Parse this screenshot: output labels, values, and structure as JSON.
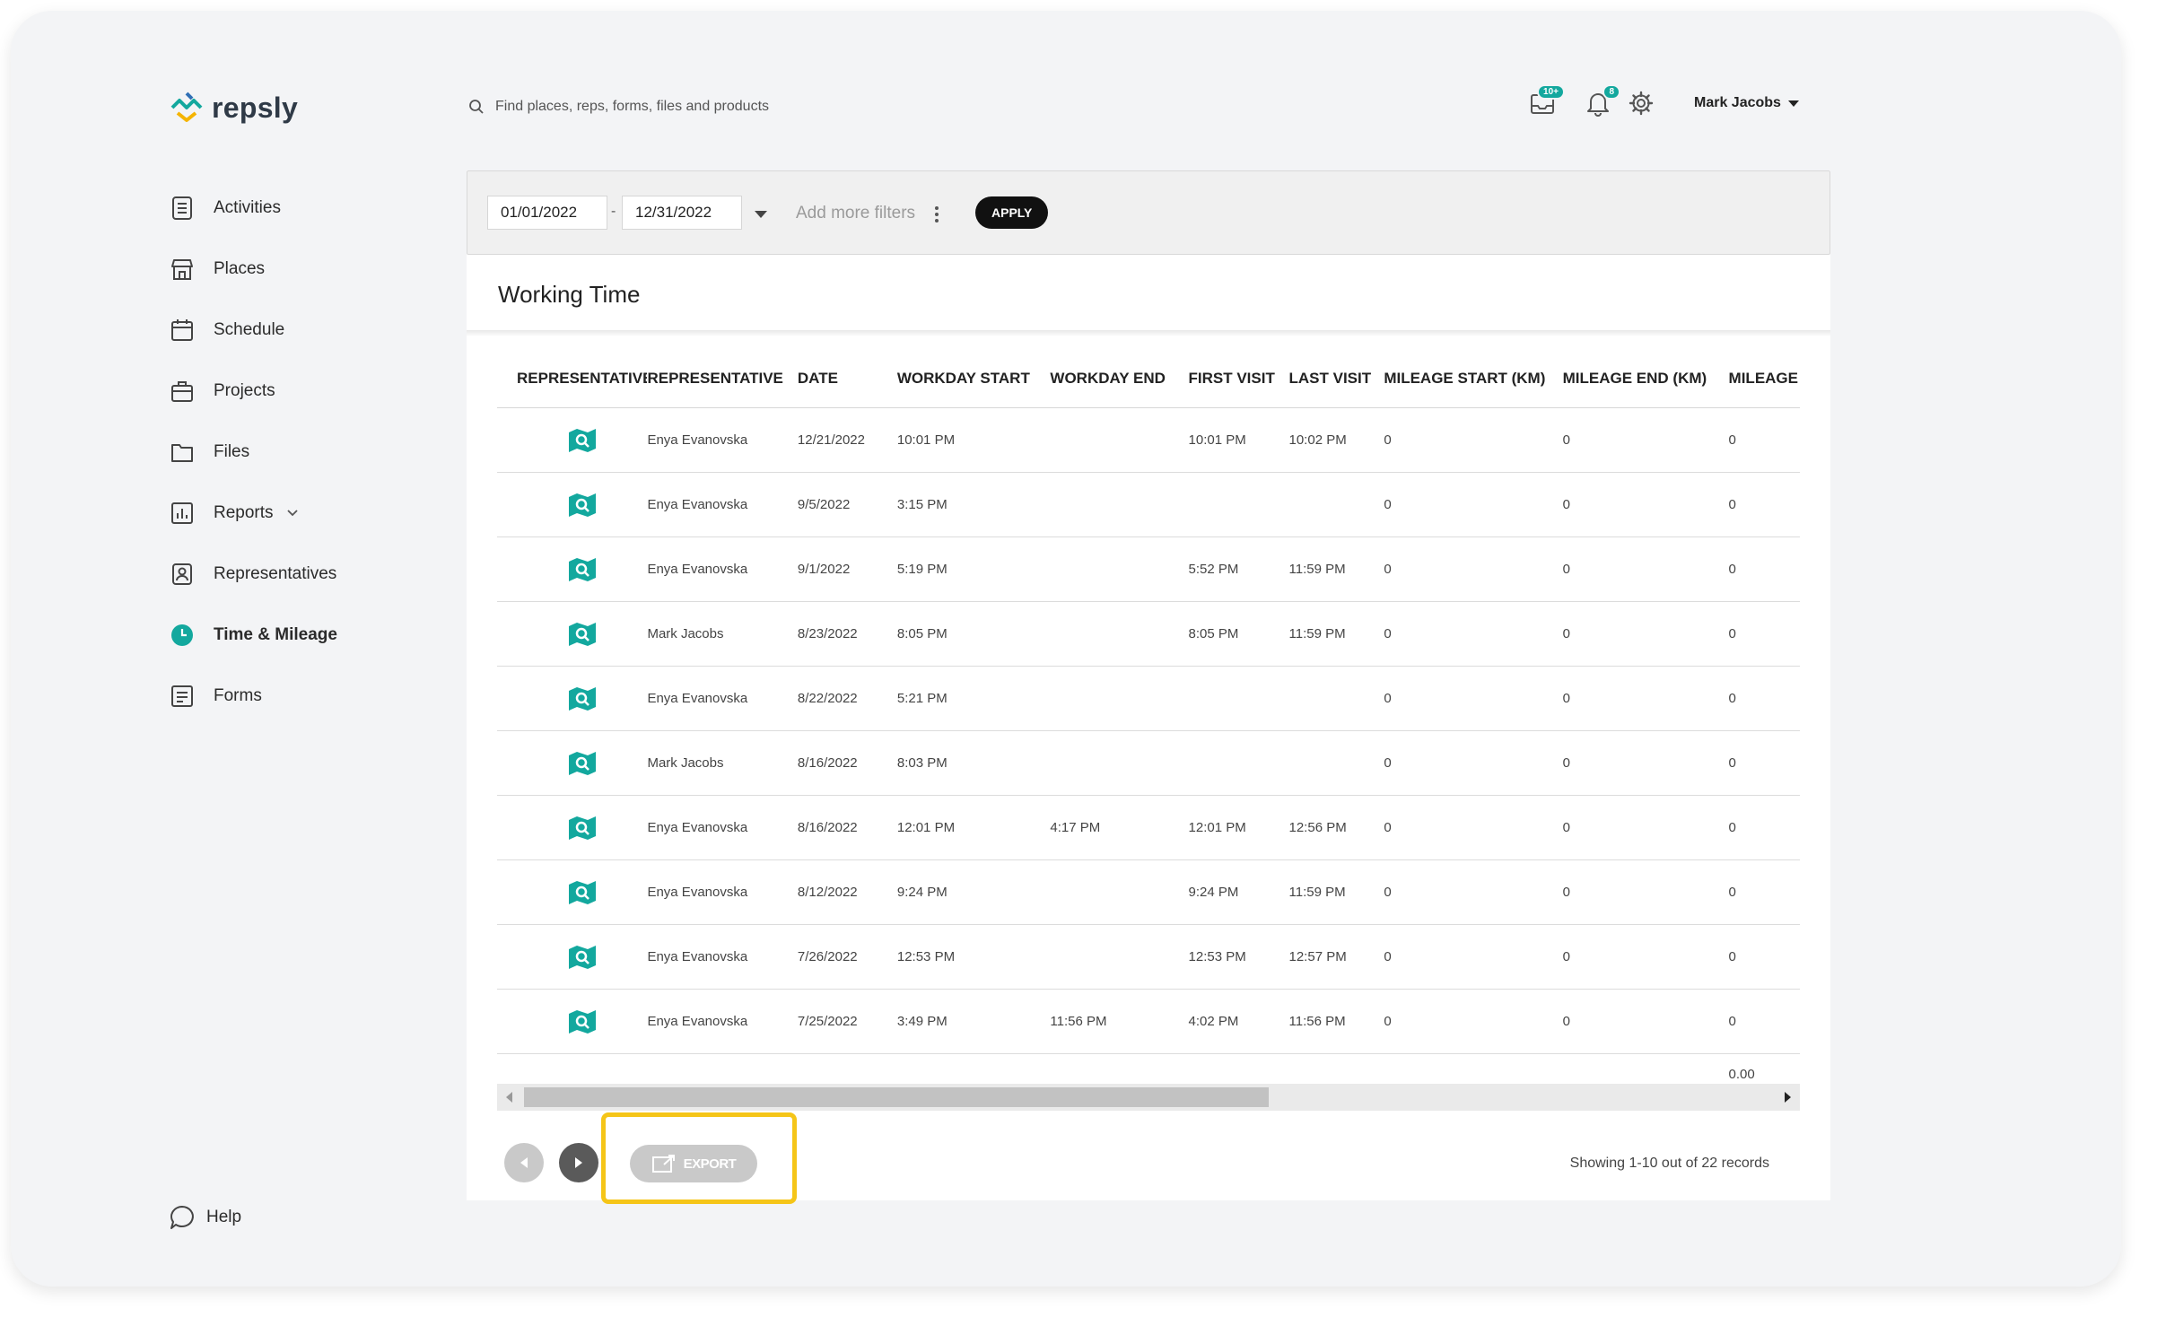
{
  "app": {
    "logo_text": "repsly",
    "brand_color": "#13a89e",
    "highlight_color": "#f5c518"
  },
  "search": {
    "placeholder": "Find places, reps, forms, files and products",
    "icon": "search-icon"
  },
  "header": {
    "inbox_badge": "10+",
    "notification_badge": "8",
    "user_name": "Mark Jacobs"
  },
  "sidebar": {
    "items": [
      {
        "label": "Activities",
        "icon": "activities-icon"
      },
      {
        "label": "Places",
        "icon": "store-icon"
      },
      {
        "label": "Schedule",
        "icon": "calendar-icon"
      },
      {
        "label": "Projects",
        "icon": "briefcase-icon"
      },
      {
        "label": "Files",
        "icon": "folder-icon"
      },
      {
        "label": "Reports",
        "icon": "chart-icon"
      },
      {
        "label": "Representatives",
        "icon": "person-icon"
      },
      {
        "label": "Time & Mileage",
        "icon": "clock-icon",
        "active": true
      },
      {
        "label": "Forms",
        "icon": "form-icon"
      }
    ],
    "help_label": "Help"
  },
  "filters": {
    "date_from": "01/01/2022",
    "date_separator": "-",
    "date_to": "12/31/2022",
    "more_filters": "Add more filters",
    "apply_label": "APPLY"
  },
  "panel": {
    "title": "Working Time"
  },
  "table": {
    "columns": [
      "REPRESENTATIVE",
      "REPRESENTATIVE",
      "DATE",
      "WORKDAY START",
      "WORKDAY END",
      "FIRST VISIT",
      "LAST VISIT",
      "MILEAGE START (KM)",
      "MILEAGE END (KM)",
      "MILEAGE TOTAL"
    ],
    "rows": [
      [
        "Enya Evanovska",
        "12/21/2022",
        "10:01 PM",
        "",
        "10:01 PM",
        "10:02 PM",
        "0",
        "0",
        "0"
      ],
      [
        "Enya Evanovska",
        "9/5/2022",
        "3:15 PM",
        "",
        "",
        "",
        "0",
        "0",
        "0"
      ],
      [
        "Enya Evanovska",
        "9/1/2022",
        "5:19 PM",
        "",
        "5:52 PM",
        "11:59 PM",
        "0",
        "0",
        "0"
      ],
      [
        "Mark Jacobs",
        "8/23/2022",
        "8:05 PM",
        "",
        "8:05 PM",
        "11:59 PM",
        "0",
        "0",
        "0"
      ],
      [
        "Enya Evanovska",
        "8/22/2022",
        "5:21 PM",
        "",
        "",
        "",
        "0",
        "0",
        "0"
      ],
      [
        "Mark Jacobs",
        "8/16/2022",
        "8:03 PM",
        "",
        "",
        "",
        "0",
        "0",
        "0"
      ],
      [
        "Enya Evanovska",
        "8/16/2022",
        "12:01 PM",
        "4:17 PM",
        "12:01 PM",
        "12:56 PM",
        "0",
        "0",
        "0"
      ],
      [
        "Enya Evanovska",
        "8/12/2022",
        "9:24 PM",
        "",
        "9:24 PM",
        "11:59 PM",
        "0",
        "0",
        "0"
      ],
      [
        "Enya Evanovska",
        "7/26/2022",
        "12:53 PM",
        "",
        "12:53 PM",
        "12:57 PM",
        "0",
        "0",
        "0"
      ],
      [
        "Enya Evanovska",
        "7/25/2022",
        "3:49 PM",
        "11:56 PM",
        "4:02 PM",
        "11:56 PM",
        "0",
        "0",
        "0"
      ]
    ],
    "total_mileage": "0.00"
  },
  "footer": {
    "export_label": "EXPORT",
    "records_text": "Showing 1-10 out of 22 records"
  }
}
